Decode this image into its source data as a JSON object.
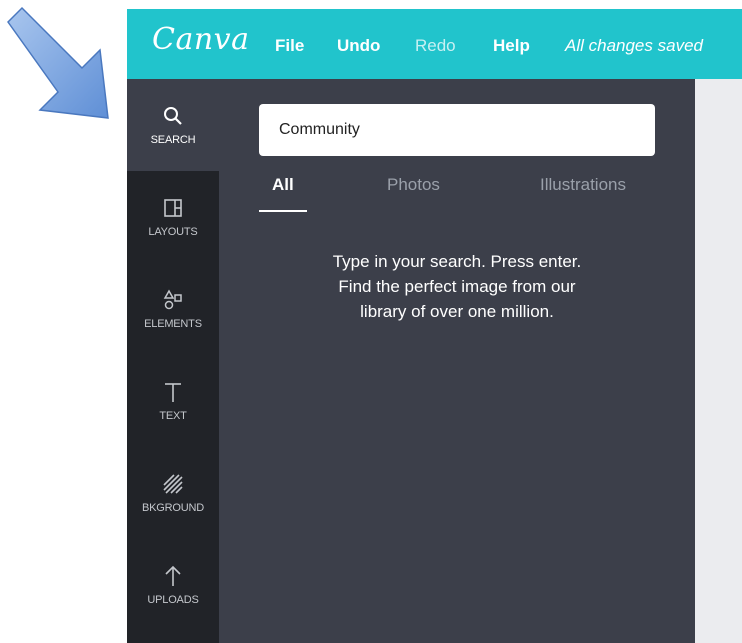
{
  "topbar": {
    "logo": "Canva",
    "menu": [
      "File",
      "Undo",
      "Redo",
      "Help"
    ],
    "status": "All changes saved",
    "accent_color": "#21c4cc"
  },
  "sidebar": {
    "items": [
      {
        "label": "SEARCH",
        "icon": "search-icon",
        "active": true
      },
      {
        "label": "LAYOUTS",
        "icon": "layouts-icon",
        "active": false
      },
      {
        "label": "ELEMENTS",
        "icon": "elements-icon",
        "active": false
      },
      {
        "label": "TEXT",
        "icon": "text-icon",
        "active": false
      },
      {
        "label": "BKGROUND",
        "icon": "background-icon",
        "active": false
      },
      {
        "label": "UPLOADS",
        "icon": "upload-icon",
        "active": false
      }
    ]
  },
  "panel": {
    "search": {
      "value": "Community"
    },
    "tabs": [
      {
        "label": "All",
        "active": true
      },
      {
        "label": "Photos",
        "active": false
      },
      {
        "label": "Illustrations",
        "active": false
      }
    ],
    "hint_lines": [
      "Type in your search. Press enter.",
      "Find the perfect image from our",
      "library of over one million."
    ]
  }
}
